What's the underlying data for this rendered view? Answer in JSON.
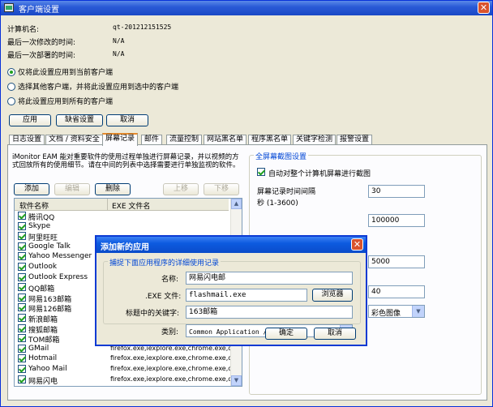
{
  "window": {
    "title": "客户端设置",
    "close": "✕"
  },
  "info": [
    {
      "label": "计算机名:",
      "value": "qt-201212151525"
    },
    {
      "label": "最后一次修改的时间:",
      "value": "N/A"
    },
    {
      "label": "最后一次部署的时间:",
      "value": "N/A"
    }
  ],
  "apply_options": [
    {
      "label": "仅将此设置应用到当前客户端",
      "selected": true
    },
    {
      "label": "选择其他客户端，并将此设置应用到选中的客户端",
      "selected": false
    },
    {
      "label": "将此设置应用到所有的客户端",
      "selected": false
    }
  ],
  "actions": {
    "apply": "应用",
    "default": "缺省设置",
    "cancel": "取消"
  },
  "tabs": [
    "日志设置",
    "文档 / 资料安全",
    "屏幕记录",
    "邮件",
    "流量控制",
    "网站黑名单",
    "程序黑名单",
    "关键字检测",
    "报警设置"
  ],
  "active_tab": 2,
  "screen": {
    "description": "iMonitor EAM 能对重要软件的使用过程单独进行屏幕记录，并以视频的方式回放所有的使用细节。请在中间的列表中选择需要进行单独监视的软件。",
    "buttons": {
      "add": "添加",
      "edit": "编辑",
      "delete": "删除",
      "up": "上移",
      "down": "下移"
    },
    "columns": [
      "软件名称",
      "EXE 文件名"
    ],
    "apps": [
      {
        "name": "腾讯QQ",
        "exe": ""
      },
      {
        "name": "Skype",
        "exe": ""
      },
      {
        "name": "阿里旺旺",
        "exe": ""
      },
      {
        "name": "Google Talk",
        "exe": ""
      },
      {
        "name": "Yahoo Messenger",
        "exe": ""
      },
      {
        "name": "Outlook",
        "exe": ""
      },
      {
        "name": "Outlook Express",
        "exe": ""
      },
      {
        "name": "QQ邮箱",
        "exe": ""
      },
      {
        "name": "网易163邮箱",
        "exe": ""
      },
      {
        "name": "网易126邮箱",
        "exe": ""
      },
      {
        "name": "新浪邮箱",
        "exe": ""
      },
      {
        "name": "搜狐邮箱",
        "exe": ""
      },
      {
        "name": "TOM邮箱",
        "exe": ""
      },
      {
        "name": "GMail",
        "exe": "firefox.exe,iexplore.exe,chrome.exe,o..."
      },
      {
        "name": "Hotmail",
        "exe": "firefox.exe,iexplore.exe,chrome.exe,o..."
      },
      {
        "name": "Yahoo Mail",
        "exe": "firefox.exe,iexplore.exe,chrome.exe,o..."
      },
      {
        "name": "网易闪电",
        "exe": "firefox.exe,iexplore.exe,chrome.exe,o..."
      }
    ],
    "fullscreen": {
      "legend": "全屏幕截图设置",
      "auto_label": "自动对整个计算机屏幕进行截图",
      "interval_label": "屏幕记录时间间隔",
      "interval_unit": "秒 (1-3600)",
      "interval_value": "30",
      "value2": "100000",
      "value3": "5000",
      "value4": "40",
      "color_mode": "彩色图像"
    }
  },
  "dialog": {
    "title": "添加新的应用",
    "close": "✕",
    "group_legend": "捕捉下面应用程序的详细使用记录",
    "name_label": "名称:",
    "name_value": "网易闪电邮",
    "exe_label": ".EXE 文件:",
    "exe_value": "flashmail.exe",
    "browse": "浏览器",
    "keyword_label": "标题中的关键字:",
    "keyword_value": "163邮箱",
    "category_label": "类别:",
    "category_value": "Common Application / 程序",
    "ok": "确定",
    "cancel": "取消"
  }
}
